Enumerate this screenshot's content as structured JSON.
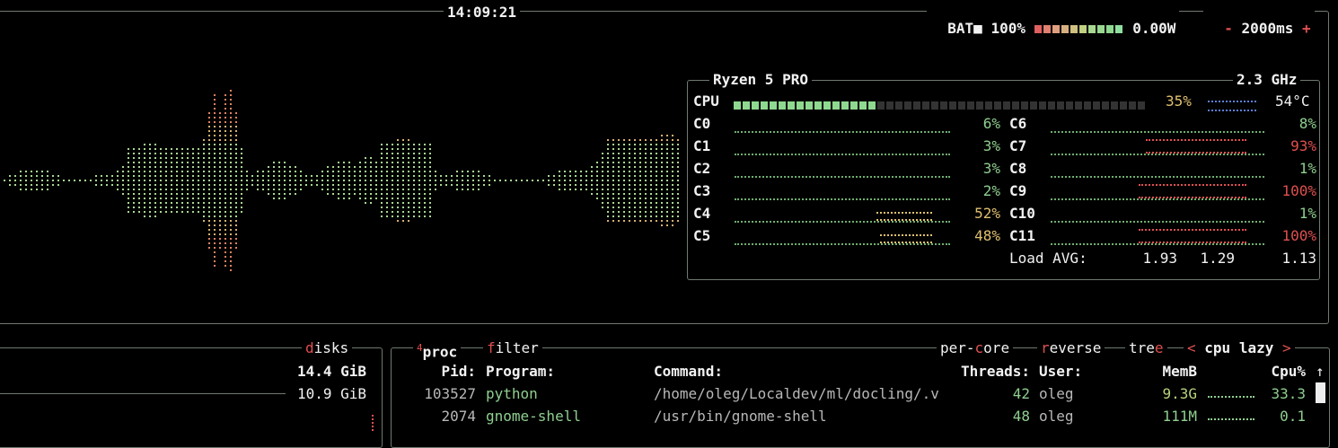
{
  "clock": "14:09:21",
  "battery": {
    "label": "BAT",
    "icon": "battery-icon",
    "percent": "100%",
    "level": 1.0,
    "power": "0.00W"
  },
  "refresh": {
    "minus": "-",
    "interval": "2000ms",
    "plus": "+"
  },
  "cpu_box": {
    "model": "Ryzen 5 PRO",
    "freq": "2.3 GHz",
    "total_label": "CPU",
    "total_percent": "35%",
    "total_level": 0.35,
    "temp": "54°C",
    "cores_left": [
      {
        "name": "C0",
        "pct": "6%"
      },
      {
        "name": "C1",
        "pct": "3%"
      },
      {
        "name": "C2",
        "pct": "3%"
      },
      {
        "name": "C3",
        "pct": "2%"
      },
      {
        "name": "C4",
        "pct": "52%"
      },
      {
        "name": "C5",
        "pct": "48%"
      }
    ],
    "cores_right": [
      {
        "name": "C6",
        "pct": "8%"
      },
      {
        "name": "C7",
        "pct": "93%"
      },
      {
        "name": "C8",
        "pct": "1%"
      },
      {
        "name": "C9",
        "pct": "100%"
      },
      {
        "name": "C10",
        "pct": "1%"
      },
      {
        "name": "C11",
        "pct": "100%"
      }
    ],
    "load_label": "Load AVG:",
    "load": [
      "1.93",
      "1.29",
      "1.13"
    ]
  },
  "mem_box": {
    "title_d": "d",
    "title_rest": "isks",
    "total": "14.4 GiB",
    "used": "10.9 GiB"
  },
  "proc_box": {
    "num": "4",
    "title": "proc",
    "filter_f": "f",
    "filter_rest": "ilter",
    "percore_a": "per-",
    "percore_c": "c",
    "percore_b": "ore",
    "reverse_r": "r",
    "reverse_rest": "everse",
    "tree_a": "tre",
    "tree_e": "e",
    "sort_left": "<",
    "sort": "cpu lazy",
    "sort_right": ">",
    "columns": {
      "pid": "Pid:",
      "program": "Program:",
      "command": "Command:",
      "threads": "Threads:",
      "user": "User:",
      "mem": "MemB",
      "cpu": "Cpu%"
    },
    "scroll_up": "↑",
    "rows": [
      {
        "pid": "103527",
        "program": "python",
        "command": "/home/oleg/Localdev/ml/docling/.v",
        "threads": "42",
        "user": "oleg",
        "mem": "9.3G",
        "cpu": "33.3"
      },
      {
        "pid": "2074",
        "program": "gnome-shell",
        "command": "/usr/bin/gnome-shell",
        "threads": "48",
        "user": "oleg",
        "mem": "111M",
        "cpu": "0.1"
      }
    ]
  },
  "colors": {
    "border": "#6f7a6f",
    "red": "#e05050",
    "green": "#8fcf8f",
    "yellow": "#e0c070"
  }
}
